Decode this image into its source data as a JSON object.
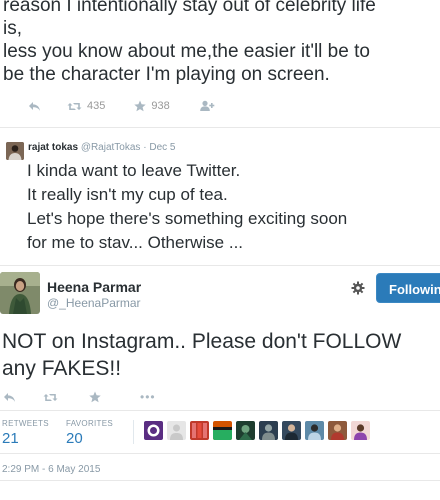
{
  "tweet1": {
    "text_lines": [
      "reason I intentionally stay out of celebrity life",
      "is,",
      "less you know about me,the easier it'll be to",
      "be the character I'm playing on screen."
    ],
    "retweet_count": "435",
    "favorite_count": "938"
  },
  "tweet2": {
    "display_name": "rajat tokas",
    "screen_name": "@RajatTokas",
    "date": "Dec 5",
    "text_lines": [
      "I kinda want to leave Twitter.",
      "It really isn't my cup of tea.",
      "Let's hope there's something exciting soon",
      "for me to stav... Otherwise ..."
    ]
  },
  "main_tweet": {
    "display_name": "Heena Parmar",
    "screen_name": "@_HeenaParmar",
    "follow_label": "Following",
    "text_lines": [
      "NOT on Instagram.. Please don't FOLLOW",
      "any FAKES!!"
    ],
    "more_label": "•••",
    "stats": {
      "retweets_label": "RETWEETS",
      "retweets": "21",
      "favorites_label": "FAVORITES",
      "favorites": "20"
    },
    "timestamp": "2:29 PM - 6 May 2015"
  },
  "colors": {
    "link_blue": "#2b7bb9",
    "icon_gray": "#aab8c2",
    "text": "#292f33"
  },
  "icons": [
    "reply-icon",
    "retweet-icon",
    "favorite-icon",
    "follow-icon",
    "more-icon",
    "gear-icon"
  ]
}
